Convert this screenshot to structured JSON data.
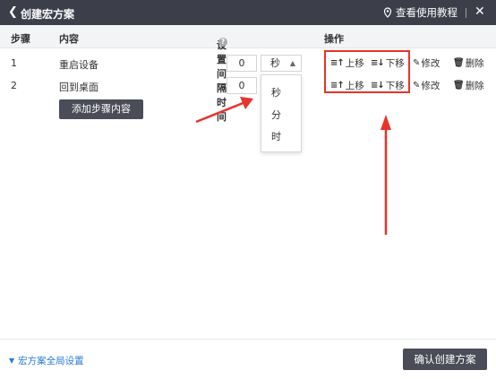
{
  "titlebar": {
    "back_icon": "chevron-left-icon",
    "title": "创建宏方案",
    "help_icon": "location-pin-icon",
    "help_label": "查看使用教程",
    "close_icon": "close-icon"
  },
  "table": {
    "headers": {
      "step": "步骤",
      "content": "内容",
      "interval": "设置间隔时间",
      "actions": "操作"
    },
    "rows": [
      {
        "step": "1",
        "content": "重启设备",
        "interval_value": "0",
        "interval_unit": "秒"
      },
      {
        "step": "2",
        "content": "回到桌面",
        "interval_value": "0",
        "interval_unit": "秒"
      }
    ],
    "actions": {
      "move_up": "上移",
      "move_down": "下移",
      "edit": "修改",
      "delete": "删除"
    },
    "add_step_label": "添加步骤内容"
  },
  "unit_dropdown": {
    "options": [
      "秒",
      "分",
      "时"
    ]
  },
  "footer": {
    "global_settings_label": "宏方案全局设置",
    "confirm_label": "确认创建方案"
  },
  "colors": {
    "titlebar_bg": "#3c3f4a",
    "button_bg": "#4a4d57",
    "highlight": "#e8332a",
    "link": "#2a7bd6"
  }
}
